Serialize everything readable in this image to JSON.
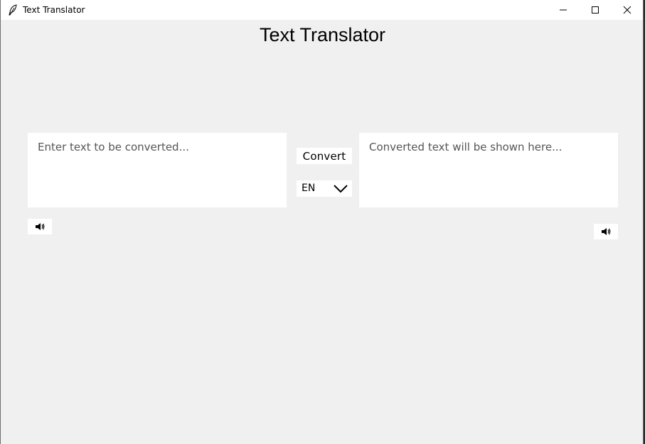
{
  "window": {
    "title": "Text Translator",
    "app_icon": "feather-icon",
    "controls": [
      "minimize-icon",
      "maximize-icon",
      "close-icon"
    ]
  },
  "header": {
    "title": "Text Translator"
  },
  "source": {
    "placeholder": "Enter text to be converted...",
    "speak_icon": "speaker-icon"
  },
  "target": {
    "placeholder": "Converted text will be shown here...",
    "speak_icon": "speaker-icon"
  },
  "actions": {
    "convert_label": "Convert"
  },
  "language": {
    "selected": "EN",
    "chevron_icon": "chevron-down-icon"
  },
  "colors": {
    "background": "#f0f0f0",
    "surface": "#ffffff",
    "placeholder_text": "#555555"
  }
}
